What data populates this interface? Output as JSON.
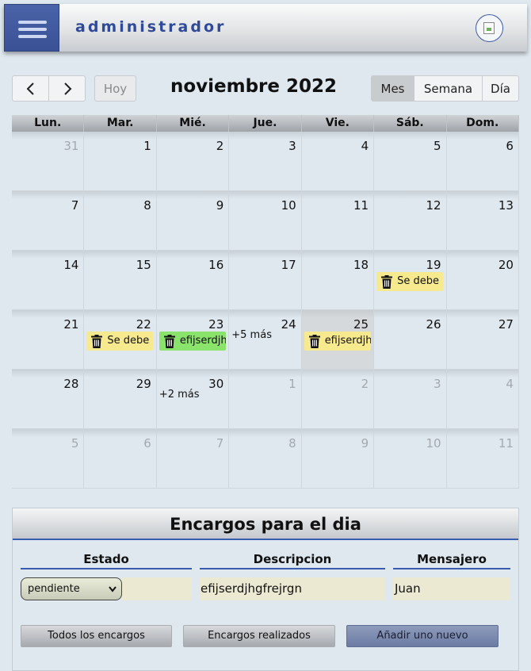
{
  "header": {
    "title": "administrador",
    "menu_icon": "hamburger-icon",
    "avatar_icon": "user-avatar-image"
  },
  "toolbar": {
    "prev_icon": "chevron-left-icon",
    "next_icon": "chevron-right-icon",
    "prev": "‹",
    "next": "›",
    "today": "Hoy",
    "title": "noviembre 2022",
    "views": {
      "month": "Mes",
      "week": "Semana",
      "day": "Día"
    },
    "active_view": "Mes"
  },
  "calendar": {
    "weekdays": [
      "Lun.",
      "Mar.",
      "Mié.",
      "Jue.",
      "Vie.",
      "Sáb.",
      "Dom."
    ],
    "weeks": [
      [
        {
          "n": "31",
          "other": true
        },
        {
          "n": "1"
        },
        {
          "n": "2"
        },
        {
          "n": "3"
        },
        {
          "n": "4"
        },
        {
          "n": "5"
        },
        {
          "n": "6"
        }
      ],
      [
        {
          "n": "7"
        },
        {
          "n": "8"
        },
        {
          "n": "9"
        },
        {
          "n": "10"
        },
        {
          "n": "11"
        },
        {
          "n": "12"
        },
        {
          "n": "13"
        }
      ],
      [
        {
          "n": "14"
        },
        {
          "n": "15"
        },
        {
          "n": "16"
        },
        {
          "n": "17"
        },
        {
          "n": "18"
        },
        {
          "n": "19",
          "event": {
            "text": "Se debe",
            "color": "yellow"
          }
        },
        {
          "n": "20"
        }
      ],
      [
        {
          "n": "21"
        },
        {
          "n": "22",
          "event": {
            "text": "Se debe",
            "color": "yellow"
          }
        },
        {
          "n": "23",
          "event": {
            "text": "efijserdjhgfrejrgn",
            "color": "green"
          }
        },
        {
          "n": "24",
          "more": "+5 más"
        },
        {
          "n": "25",
          "today": true,
          "event": {
            "text": "efijserdjhgfrejrgn",
            "color": "yellow"
          }
        },
        {
          "n": "26"
        },
        {
          "n": "27"
        }
      ],
      [
        {
          "n": "28"
        },
        {
          "n": "29"
        },
        {
          "n": "30",
          "more": "+2 más"
        },
        {
          "n": "1",
          "other": true
        },
        {
          "n": "2",
          "other": true
        },
        {
          "n": "3",
          "other": true
        },
        {
          "n": "4",
          "other": true
        }
      ],
      [
        {
          "n": "5",
          "other": true
        },
        {
          "n": "6",
          "other": true
        },
        {
          "n": "7",
          "other": true
        },
        {
          "n": "8",
          "other": true
        },
        {
          "n": "9",
          "other": true
        },
        {
          "n": "10",
          "other": true
        },
        {
          "n": "11",
          "other": true
        }
      ]
    ],
    "event_colors": {
      "yellow": "#f7e98e",
      "green": "#8ae36b"
    }
  },
  "panel": {
    "title": "Encargos para el dia",
    "columns": {
      "estado": "Estado",
      "descripcion": "Descripcion",
      "mensajero": "Mensajero"
    },
    "row": {
      "estado": "pendiente",
      "descripcion": "efijserdjhgfrejrgn",
      "mensajero": "Juan"
    },
    "buttons": {
      "all": "Todos los encargos",
      "done": "Encargos realizados",
      "add": "Añadir uno nuevo"
    }
  }
}
